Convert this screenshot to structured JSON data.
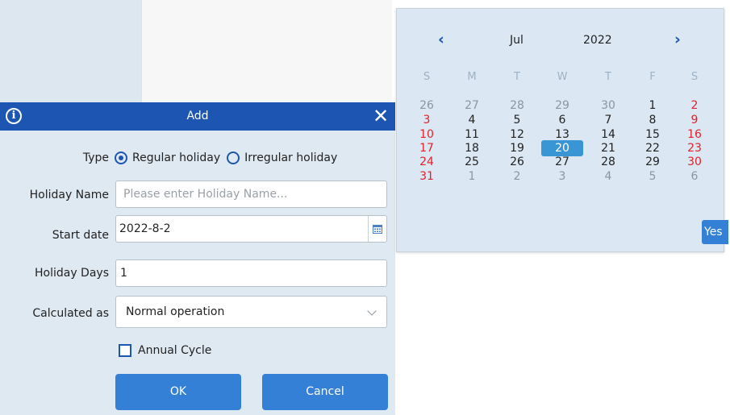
{
  "dialog": {
    "title": "Add",
    "close_glyph": "✕",
    "info_glyph": "i",
    "type": {
      "label": "Type",
      "options": [
        "Regular holiday",
        "Irregular holiday"
      ],
      "selected": "Regular holiday"
    },
    "holiday_name": {
      "label": "Holiday Name",
      "placeholder": "Please enter Holiday Name..."
    },
    "start_date": {
      "label": "Start date",
      "value": "2022-8-2"
    },
    "holiday_days": {
      "label": "Holiday Days",
      "value": "1"
    },
    "calculated_as": {
      "label": "Calculated as",
      "value": "Normal operation"
    },
    "annual_cycle": {
      "label": "Annual Cycle",
      "checked": false
    },
    "ok_label": "OK",
    "cancel_label": "Cancel"
  },
  "datepicker": {
    "month": "Jul",
    "year": "2022",
    "prev_glyph": "‹",
    "next_glyph": "›",
    "weekdays": [
      "S",
      "M",
      "T",
      "W",
      "T",
      "F",
      "S"
    ],
    "weeks": [
      [
        "26",
        "27",
        "28",
        "29",
        "30",
        "1",
        "2"
      ],
      [
        "3",
        "4",
        "5",
        "6",
        "7",
        "8",
        "9"
      ],
      [
        "10",
        "11",
        "12",
        "13",
        "14",
        "15",
        "16"
      ],
      [
        "17",
        "18",
        "19",
        "20",
        "21",
        "22",
        "23"
      ],
      [
        "24",
        "25",
        "26",
        "27",
        "28",
        "29",
        "30"
      ],
      [
        "31",
        "1",
        "2",
        "3",
        "4",
        "5",
        "6"
      ]
    ],
    "selected_day": "20",
    "yes_label": "Yes"
  },
  "icons": {
    "info": "info-icon",
    "close": "close-icon",
    "calendar": "calendar-icon",
    "dropdown": "chevron-down-icon",
    "prev": "chevron-left-icon",
    "next": "chevron-right-icon"
  },
  "colors": {
    "header": "#1d55b3",
    "button": "#3480d6",
    "panel": "#dfe9f2",
    "weekend": "#e0222a",
    "selected_day": "#3a95d4"
  }
}
